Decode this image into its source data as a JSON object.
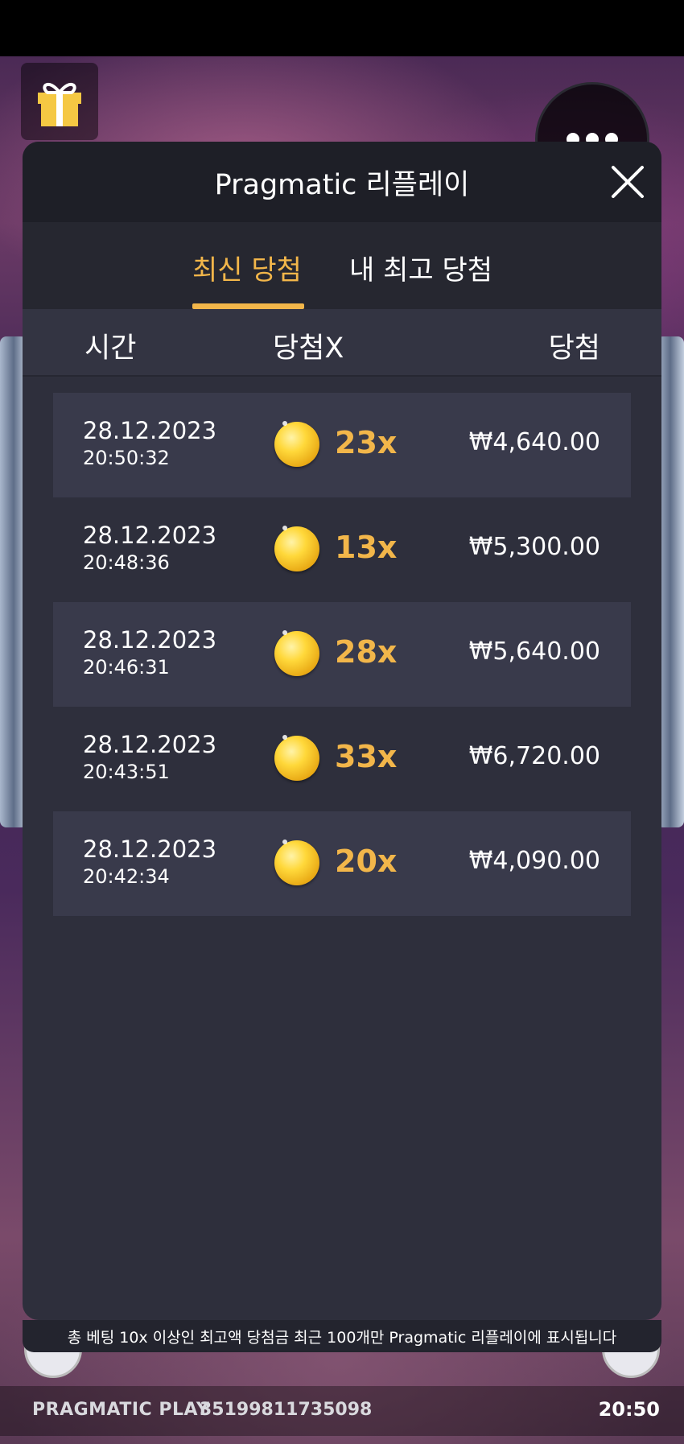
{
  "modal": {
    "title": "Pragmatic 리플레이",
    "tabs": [
      {
        "label": "최신 당첨",
        "active": true
      },
      {
        "label": "내 최고 당첨",
        "active": false
      }
    ],
    "columns": {
      "time": "시간",
      "multiplier": "당첨X",
      "win": "당첨"
    },
    "rows": [
      {
        "date": "28.12.2023",
        "time": "20:50:32",
        "multiplier": "23x",
        "amount": "₩4,640.00"
      },
      {
        "date": "28.12.2023",
        "time": "20:48:36",
        "multiplier": "13x",
        "amount": "₩5,300.00"
      },
      {
        "date": "28.12.2023",
        "time": "20:46:31",
        "multiplier": "28x",
        "amount": "₩5,640.00"
      },
      {
        "date": "28.12.2023",
        "time": "20:43:51",
        "multiplier": "33x",
        "amount": "₩6,720.00"
      },
      {
        "date": "28.12.2023",
        "time": "20:42:34",
        "multiplier": "20x",
        "amount": "₩4,090.00"
      }
    ],
    "footer_note": "총 베팅 10x 이상인 최고액 당첨금 최근 100개만 Pragmatic 리플레이에 표시됩니다"
  },
  "game": {
    "brand": "PRAGMATIC PLAY",
    "session_id": "35199811735098",
    "clock": "20:50"
  },
  "icons": {
    "gift": "gift-icon",
    "menu": "more-dots-icon",
    "close": "close-icon",
    "coin": "coin-icon"
  },
  "colors": {
    "accent": "#f2b64a",
    "panel": "#2e2f3c",
    "header": "#1e1f27"
  }
}
